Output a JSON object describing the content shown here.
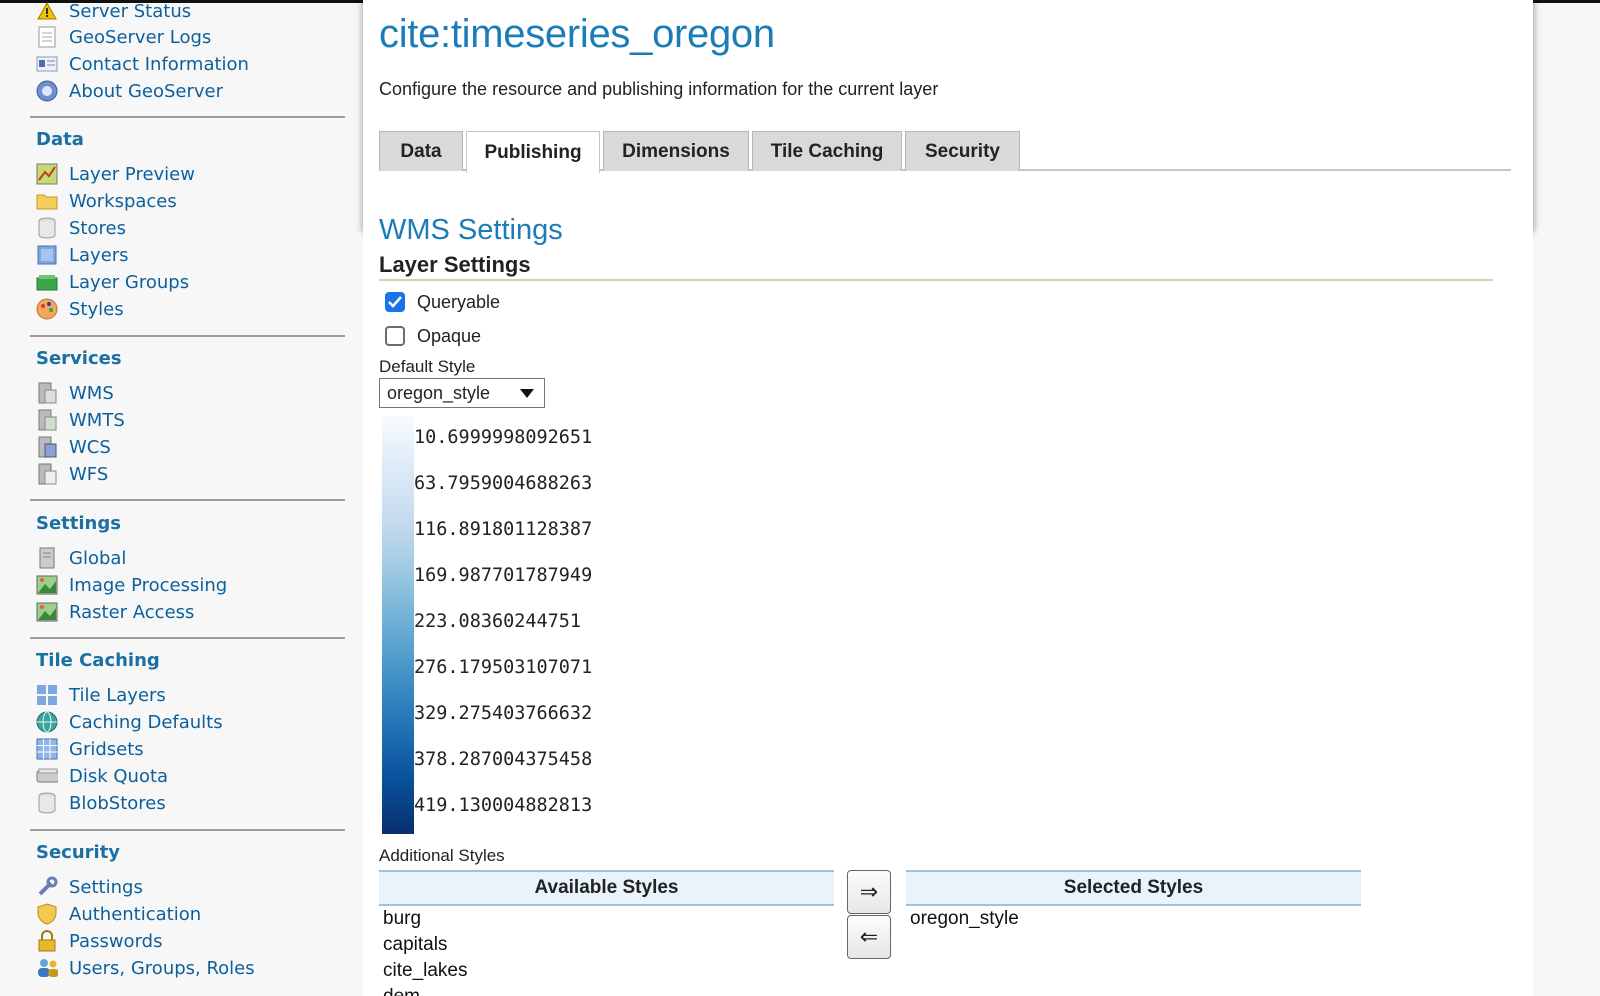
{
  "sidebar": {
    "top_items": [
      {
        "label": "Server Status",
        "icon": "warning-icon"
      },
      {
        "label": "GeoServer Logs",
        "icon": "document-icon"
      },
      {
        "label": "Contact Information",
        "icon": "contact-card-icon"
      },
      {
        "label": "About GeoServer",
        "icon": "info-globe-icon"
      }
    ],
    "sections": [
      {
        "title": "Data",
        "items": [
          "Layer Preview",
          "Workspaces",
          "Stores",
          "Layers",
          "Layer Groups",
          "Styles"
        ]
      },
      {
        "title": "Services",
        "items": [
          "WMS",
          "WMTS",
          "WCS",
          "WFS"
        ]
      },
      {
        "title": "Settings",
        "items": [
          "Global",
          "Image Processing",
          "Raster Access"
        ]
      },
      {
        "title": "Tile Caching",
        "items": [
          "Tile Layers",
          "Caching Defaults",
          "Gridsets",
          "Disk Quota",
          "BlobStores"
        ]
      },
      {
        "title": "Security",
        "items": [
          "Settings",
          "Authentication",
          "Passwords",
          "Users, Groups, Roles"
        ]
      }
    ]
  },
  "main": {
    "title": "cite:timeseries_oregon",
    "description": "Configure the resource and publishing information for the current layer",
    "tabs": [
      "Data",
      "Publishing",
      "Dimensions",
      "Tile Caching",
      "Security"
    ],
    "active_tab": "Publishing",
    "wms_title": "WMS Settings",
    "layer_settings_title": "Layer Settings",
    "queryable_label": "Queryable",
    "queryable_checked": true,
    "opaque_label": "Opaque",
    "opaque_checked": false,
    "default_style_label": "Default Style",
    "default_style_value": "oregon_style",
    "legend_values": [
      "10.6999998092651",
      "63.7959004688263",
      "116.891801128387",
      "169.987701787949",
      "223.08360244751",
      "276.179503107071",
      "329.275403766632",
      "378.287004375458",
      "419.130004882813"
    ],
    "additional_styles_label": "Additional Styles",
    "available_styles_header": "Available Styles",
    "selected_styles_header": "Selected Styles",
    "available_styles": [
      "burg",
      "capitals",
      "cite_lakes",
      "dem"
    ],
    "selected_styles": [
      "oregon_style"
    ],
    "move_right_label": "⇒",
    "move_left_label": "⇐"
  },
  "colors": {
    "link": "#0d5f9c",
    "title": "#1b7db8",
    "checkbox": "#1a73e8",
    "ramp_light": "#f7fbff",
    "ramp_dark": "#08306b"
  }
}
